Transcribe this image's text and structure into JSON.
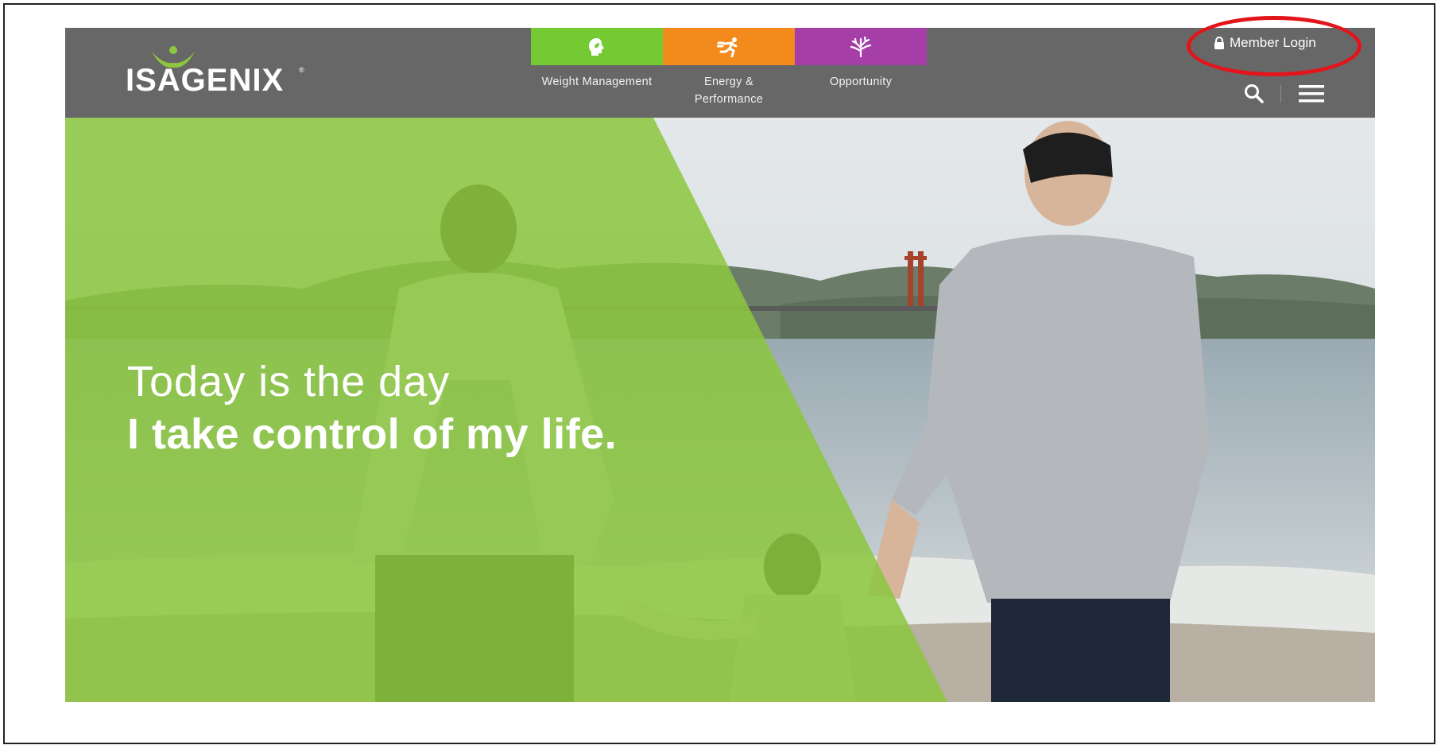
{
  "brand": {
    "name": "ISAGENIX",
    "reg": "®"
  },
  "nav": [
    {
      "label": "Weight Management",
      "color": "#75c933",
      "icon": "head-leaf-icon"
    },
    {
      "label": "Energy & Performance",
      "color": "#f38a1c",
      "icon": "running-figure-icon"
    },
    {
      "label": "Opportunity",
      "color": "#a63ea8",
      "icon": "tree-icon"
    }
  ],
  "header": {
    "member_login": "Member Login",
    "color": "#676767"
  },
  "hero": {
    "line1": "Today is the day",
    "line2": "I take control of my life.",
    "overlay_color": "#8cc63f"
  },
  "annotation": {
    "color": "#e3141a"
  }
}
